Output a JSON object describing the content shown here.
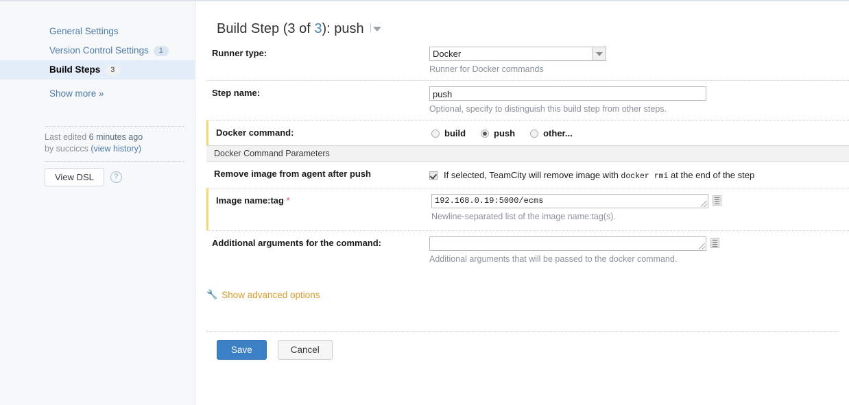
{
  "sidebar": {
    "items": [
      {
        "label": "General Settings",
        "badge": null,
        "active": false
      },
      {
        "label": "Version Control Settings",
        "badge": "1",
        "active": false
      },
      {
        "label": "Build Steps",
        "badge": "3",
        "active": true
      }
    ],
    "show_more": "Show more »",
    "last_edited_prefix": "Last edited ",
    "last_edited_time": "6 minutes ago",
    "last_edited_by": "by succiccs",
    "view_history": "(view history)",
    "view_dsl_label": "View DSL",
    "help_icon": "question-icon"
  },
  "header": {
    "title_prefix": "Build Step (",
    "title_index": "3",
    "title_mid": " of ",
    "title_total": "3",
    "title_suffix": "): push",
    "caret_icon": "chevron-down-icon"
  },
  "form": {
    "runner_type": {
      "label": "Runner type:",
      "value": "Docker",
      "hint": "Runner for Docker commands",
      "dropdown_icon": "chevron-down-icon"
    },
    "step_name": {
      "label": "Step name:",
      "value": "push",
      "placeholder": "",
      "hint": "Optional, specify to distinguish this build step from other steps."
    },
    "docker_command": {
      "label": "Docker command:",
      "options": [
        {
          "label": "build",
          "checked": false
        },
        {
          "label": "push",
          "checked": true
        },
        {
          "label": "other...",
          "checked": false
        }
      ]
    },
    "parameters_section_title": "Docker Command Parameters",
    "remove_image": {
      "label": "Remove image from agent after push",
      "checked": true,
      "text_before": "If selected, TeamCity will remove image with ",
      "text_mono": "docker rmi",
      "text_after": " at the end of the step"
    },
    "image_name_tag": {
      "label": "Image name:tag",
      "required_marker": "*",
      "value": "192.168.0.19:5000/ecms",
      "placeholder": "",
      "hint": "Newline-separated list of the image name:tag(s).",
      "expand_icon": "expand-editor-icon"
    },
    "additional_arguments": {
      "label": "Additional arguments for the command:",
      "value": "",
      "placeholder": "",
      "hint": "Additional arguments that will be passed to the docker command.",
      "expand_icon": "expand-editor-icon"
    },
    "advanced": {
      "label": "Show advanced options",
      "icon": "wrench-icon"
    }
  },
  "footer": {
    "save_label": "Save",
    "cancel_label": "Cancel"
  },
  "colors": {
    "accent_blue": "#3b7fc4",
    "link_blue": "#4e7aa7",
    "highlight_yellow": "#f5d76e",
    "advanced_orange": "#d89b2a",
    "required_red": "#d9534f",
    "sidebar_bg": "#f6f8f9",
    "active_bg": "#e3eefa"
  }
}
